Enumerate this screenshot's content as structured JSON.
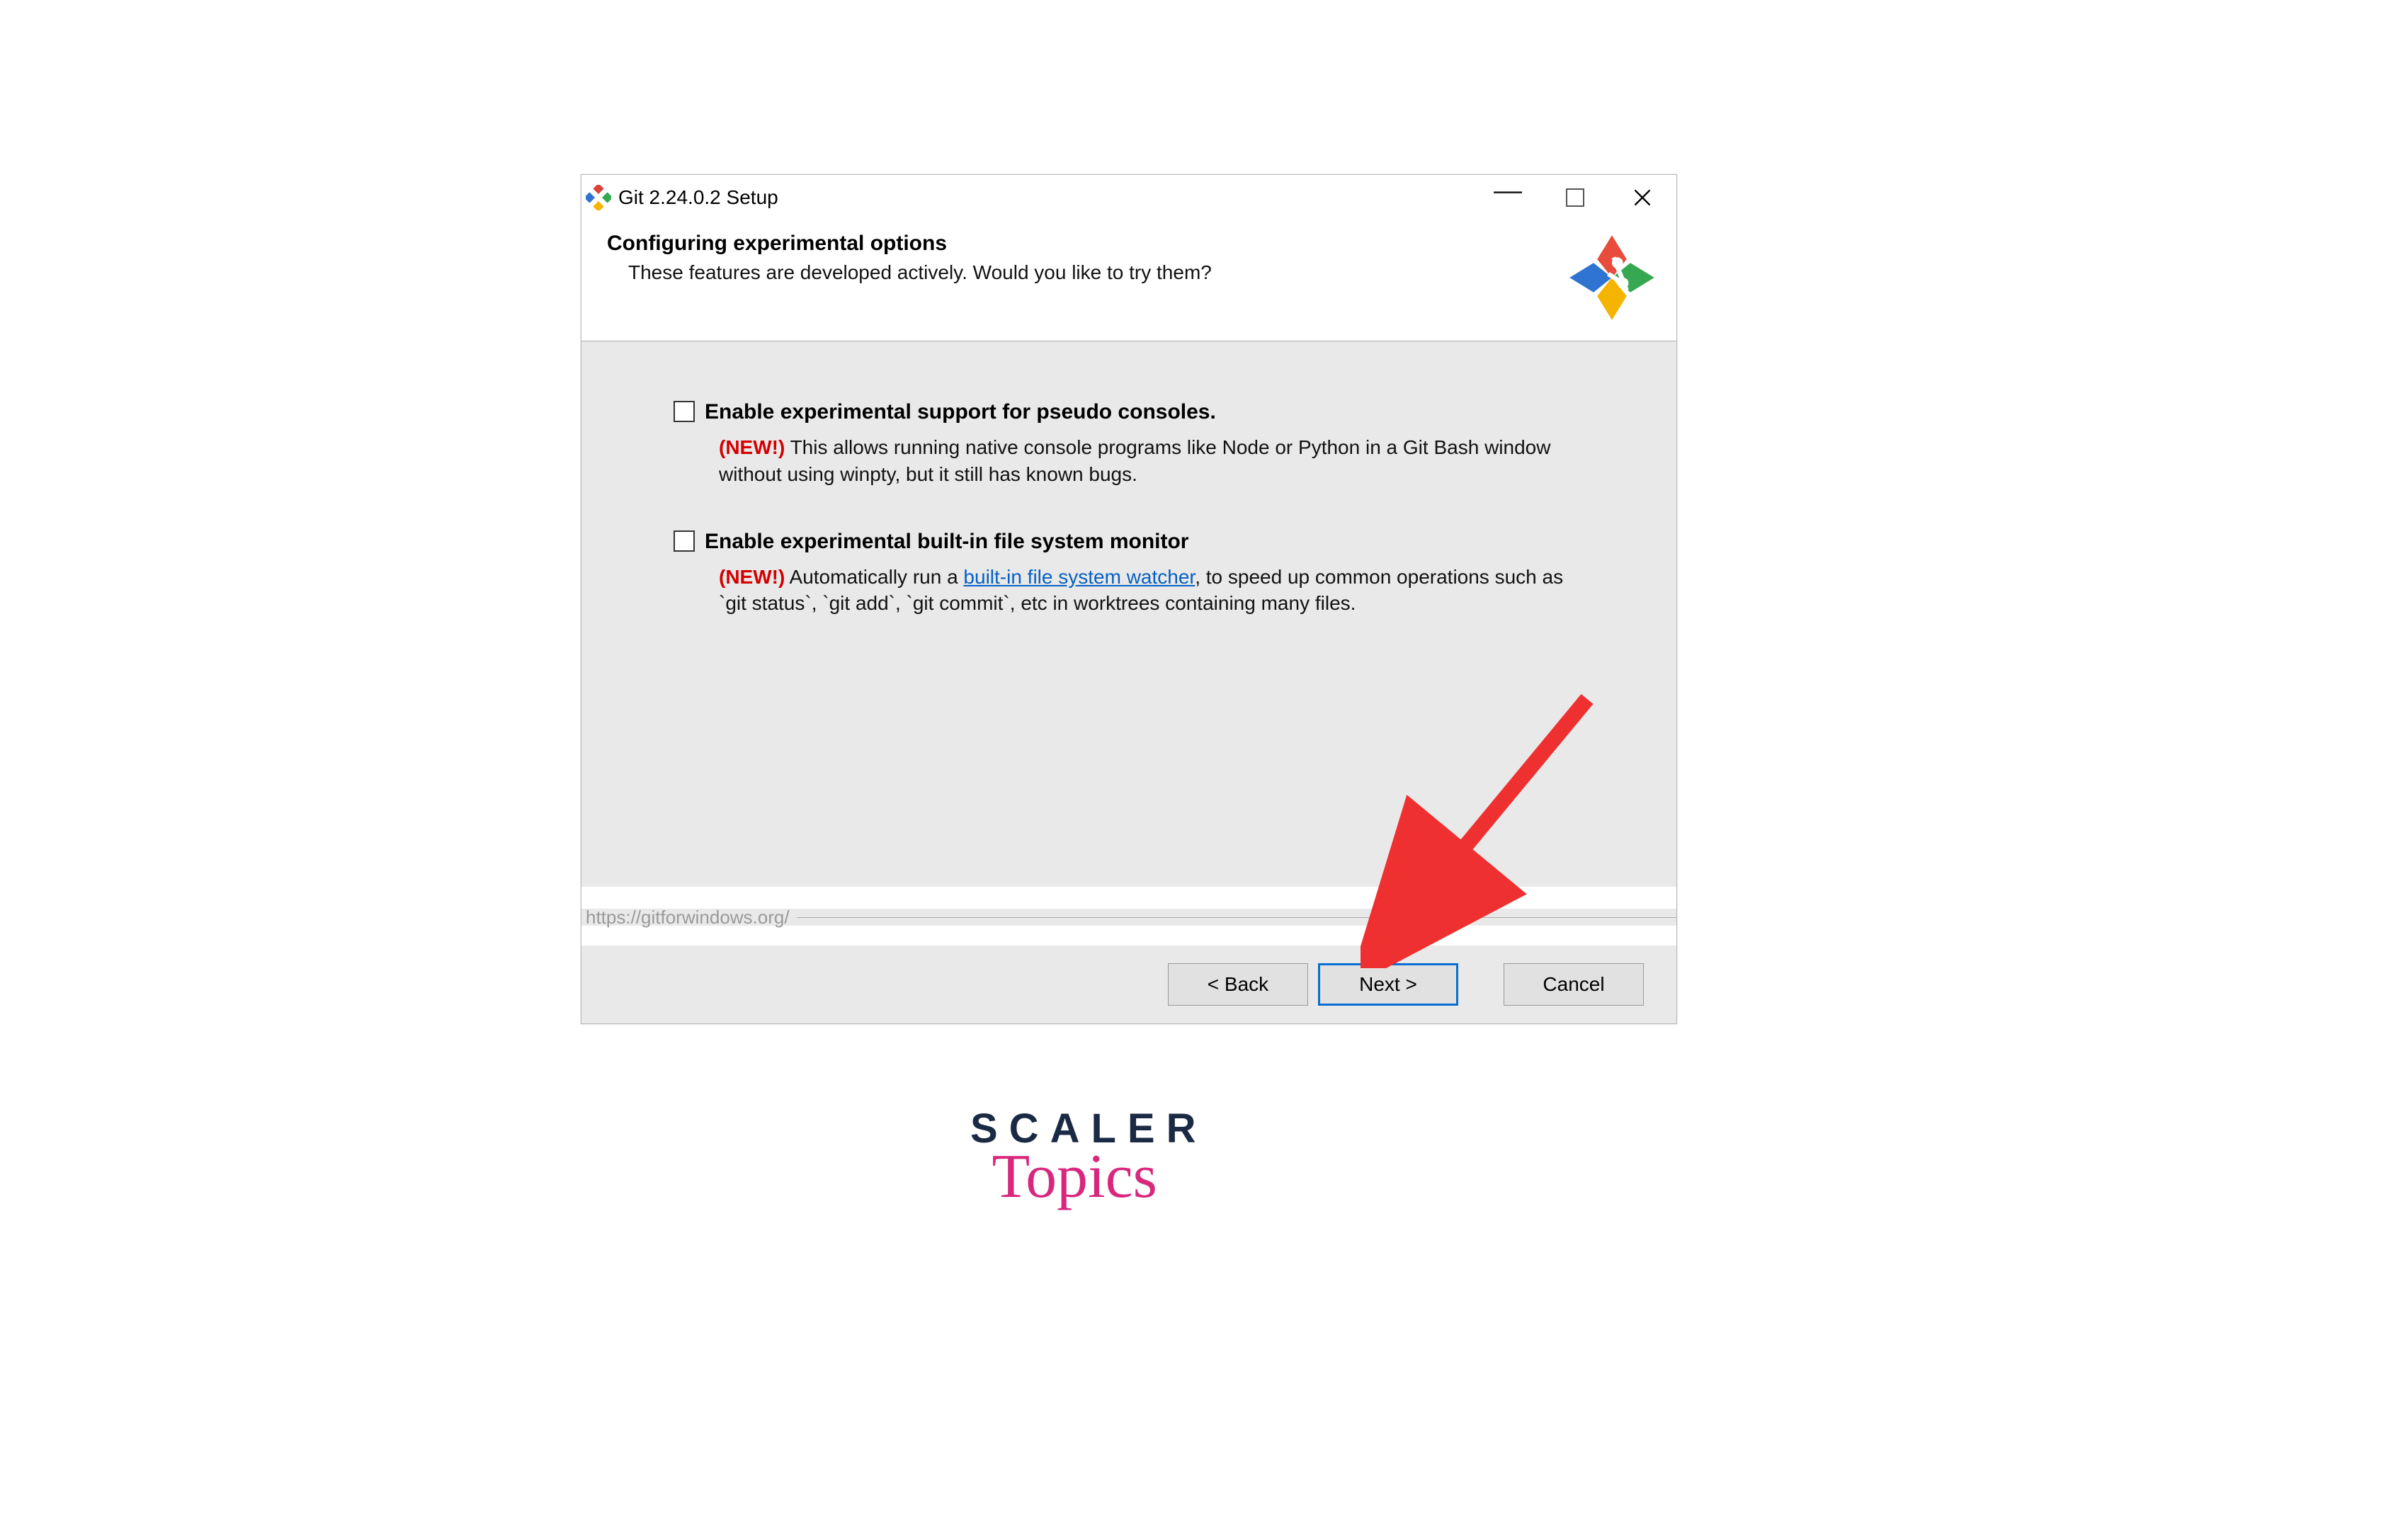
{
  "titlebar": {
    "title": "Git 2.24.0.2 Setup"
  },
  "header": {
    "title": "Configuring experimental options",
    "subtitle": "These features are developed actively. Would you like to try them?"
  },
  "options": [
    {
      "label": "Enable experimental support for pseudo consoles.",
      "badge": "(NEW!)",
      "desc_rest": " This allows running native console programs like Node or Python in a Git Bash window without using winpty, but it still has known bugs.",
      "checked": false
    },
    {
      "label": "Enable experimental built-in file system monitor",
      "badge": "(NEW!)",
      "desc_pre": " Automatically run a ",
      "link_text": "built-in file system watcher",
      "desc_post": ", to speed up common operations such as `git status`, `git add`, `git commit`, etc in worktrees containing many files.",
      "checked": false
    }
  ],
  "footer": {
    "url": "https://gitforwindows.org/",
    "back": "< Back",
    "next": "Next >",
    "cancel": "Cancel"
  },
  "branding": {
    "line1": "SCALER",
    "line2": "Topics"
  }
}
